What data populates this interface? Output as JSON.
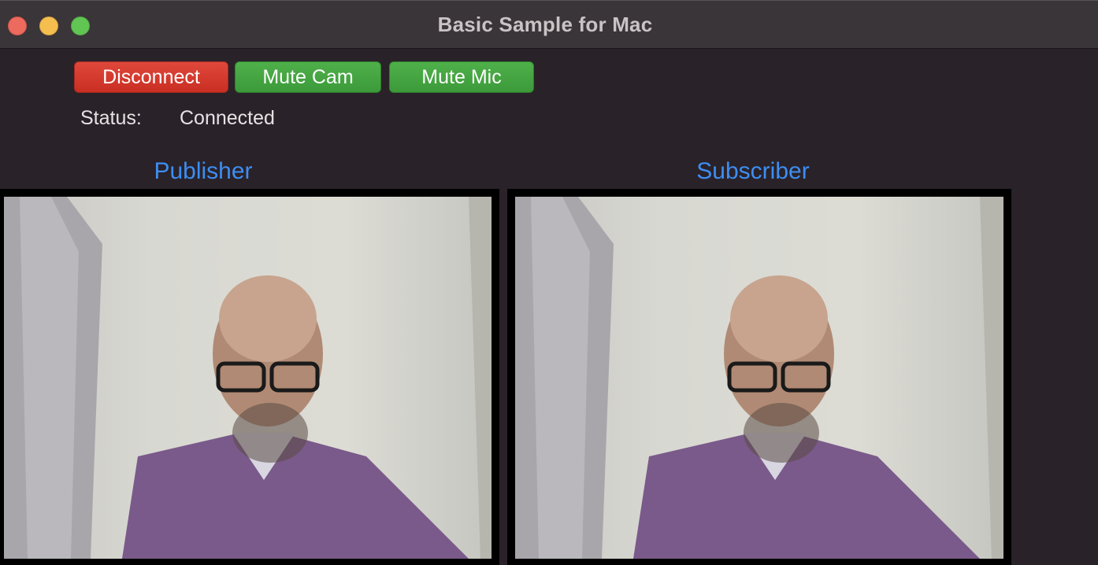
{
  "window": {
    "title": "Basic Sample for Mac"
  },
  "toolbar": {
    "disconnect_label": "Disconnect",
    "mute_cam_label": "Mute Cam",
    "mute_mic_label": "Mute Mic"
  },
  "status": {
    "label": "Status:",
    "value": "Connected"
  },
  "panes": {
    "publisher_label": "Publisher",
    "subscriber_label": "Subscriber"
  },
  "colors": {
    "disconnect": "#d63a2f",
    "mute_buttons": "#43a33f",
    "pane_labels": "#3d8ef2"
  }
}
